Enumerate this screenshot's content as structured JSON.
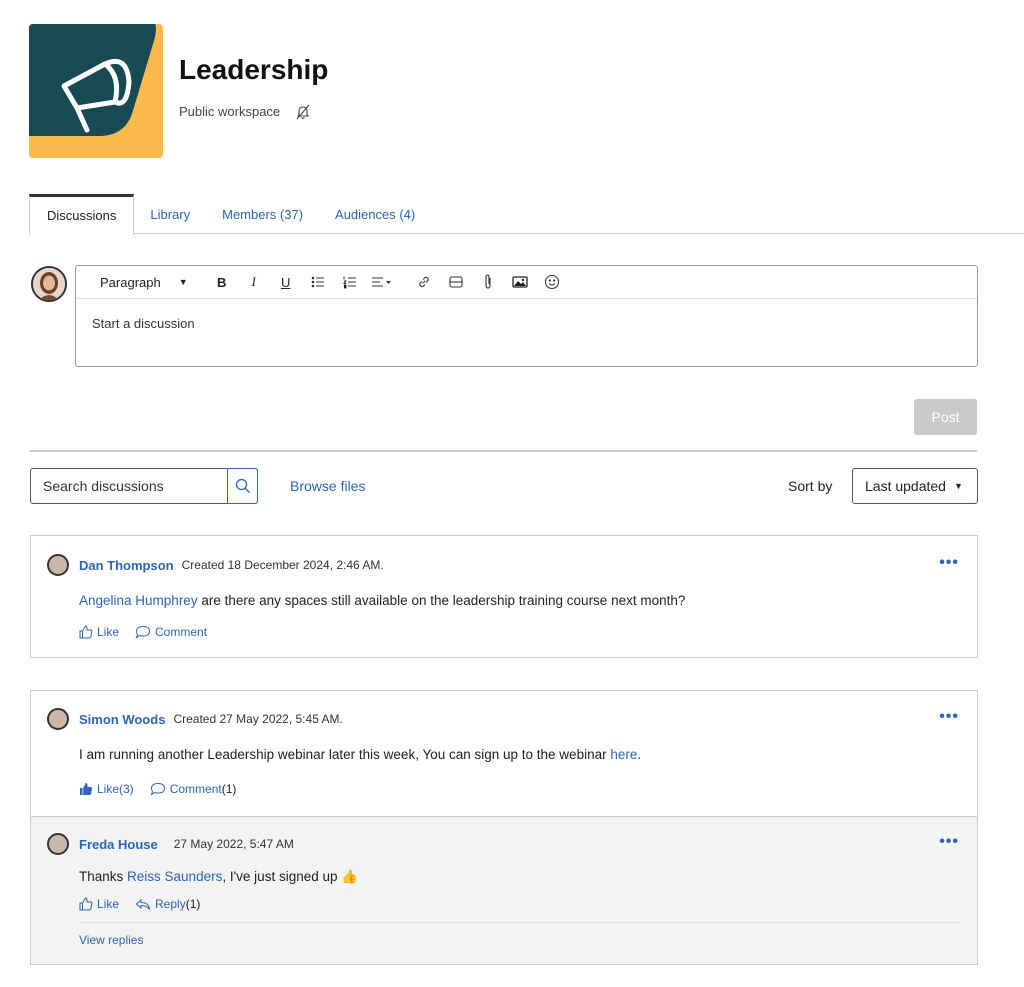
{
  "workspace": {
    "title": "Leadership",
    "subtitle": "Public workspace",
    "logo_bg": "#ffba4d",
    "logo_fg": "#174a52"
  },
  "tabs": [
    {
      "label": "Discussions",
      "active": true
    },
    {
      "label": "Library"
    },
    {
      "label": "Members (37)"
    },
    {
      "label": "Audiences (4)"
    }
  ],
  "composer": {
    "format": "Paragraph",
    "placeholder": "Start a discussion",
    "post_label": "Post",
    "toolbar_icons": [
      "bold-icon",
      "italic-icon",
      "underline-icon",
      "bullet-list-icon",
      "numbered-list-icon",
      "align-icon",
      "link-icon",
      "embed-icon",
      "attachment-icon",
      "image-icon",
      "emoji-icon"
    ]
  },
  "filters": {
    "search_placeholder": "Search discussions",
    "browse_files": "Browse files",
    "sort_by_label": "Sort by",
    "sort_value": "Last updated"
  },
  "posts": [
    {
      "author": "Dan Thompson",
      "meta": "Created 18 December 2024, 2:46 AM.",
      "mention": "Angelina Humphrey",
      "text": " are there any spaces still available on the leadership training course next month?",
      "like_label": "Like",
      "comment_label": "Comment"
    },
    {
      "author": "Simon Woods",
      "meta": "Created 27 May 2022, 5:45 AM.",
      "text": "I am running another Leadership webinar later this week, You can sign up to the webinar ",
      "link": "here",
      "text_end": ".",
      "like_label": "Like",
      "like_count": "(3)",
      "comment_label": "Comment",
      "comment_count": "(1)",
      "reply": {
        "author": "Freda House",
        "meta": "27 May 2022, 5:47 AM",
        "text_start": "Thanks ",
        "mention": "Reiss Saunders",
        "text_end": ", I've just signed up ",
        "emoji": "👍",
        "like_label": "Like",
        "reply_label": "Reply",
        "reply_count": "(1)",
        "view_replies": "View replies"
      }
    }
  ],
  "colors": {
    "link": "#2f64b6",
    "post_button_disabled": "#c9c9c9"
  }
}
